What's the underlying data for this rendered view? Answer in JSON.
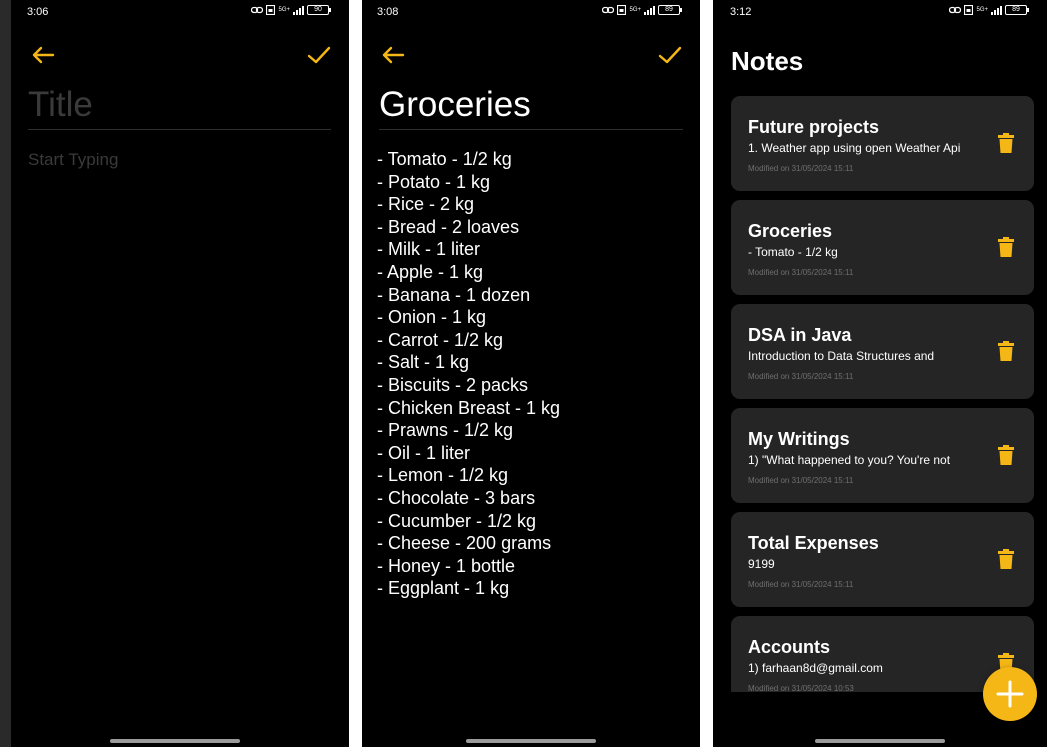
{
  "accent_color": "#f5b716",
  "screens": [
    {
      "name": "new-note-editor",
      "status": {
        "time": "3:06",
        "battery": "90",
        "network": "5G+"
      },
      "title_placeholder": "Title",
      "body_placeholder": "Start Typing"
    },
    {
      "name": "note-editor",
      "status": {
        "time": "3:08",
        "battery": "89",
        "network": "5G+"
      },
      "title": "Groceries",
      "lines": [
        "- Tomato - 1/2 kg",
        "- Potato - 1 kg",
        "- Rice - 2 kg",
        "- Bread - 2 loaves",
        "- Milk - 1 liter",
        "- Apple - 1 kg",
        "- Banana - 1 dozen",
        "- Onion - 1 kg",
        "- Carrot - 1/2 kg",
        "- Salt - 1 kg",
        "- Biscuits - 2 packs",
        "- Chicken Breast - 1 kg",
        "- Prawns - 1/2 kg",
        "- Oil - 1 liter",
        "- Lemon - 1/2 kg",
        "- Chocolate - 3 bars",
        "- Cucumber - 1/2 kg",
        "- Cheese - 200 grams",
        "- Honey - 1 bottle",
        "- Eggplant - 1 kg"
      ]
    },
    {
      "name": "notes-list",
      "status": {
        "time": "3:12",
        "battery": "89",
        "network": "5G+"
      },
      "heading": "Notes",
      "notes": [
        {
          "title": "Future projects",
          "preview": "1. Weather app using open Weather Api",
          "modified": "Modified on 31/05/2024 15:11"
        },
        {
          "title": "Groceries",
          "preview": "- Tomato - 1/2 kg",
          "modified": "Modified on 31/05/2024 15:11"
        },
        {
          "title": "DSA in Java",
          "preview": "Introduction to Data Structures and",
          "modified": "Modified on 31/05/2024 15:11"
        },
        {
          "title": "My Writings",
          "preview": "1) \"What happened to you? You're not",
          "modified": "Modified on 31/05/2024 15:11"
        },
        {
          "title": "Total Expenses",
          "preview": "9199",
          "modified": "Modified on 31/05/2024 15:11"
        },
        {
          "title": "Accounts",
          "preview": "1) farhaan8d@gmail.com",
          "modified": "Modified on 31/05/2024 10:53"
        }
      ]
    }
  ]
}
